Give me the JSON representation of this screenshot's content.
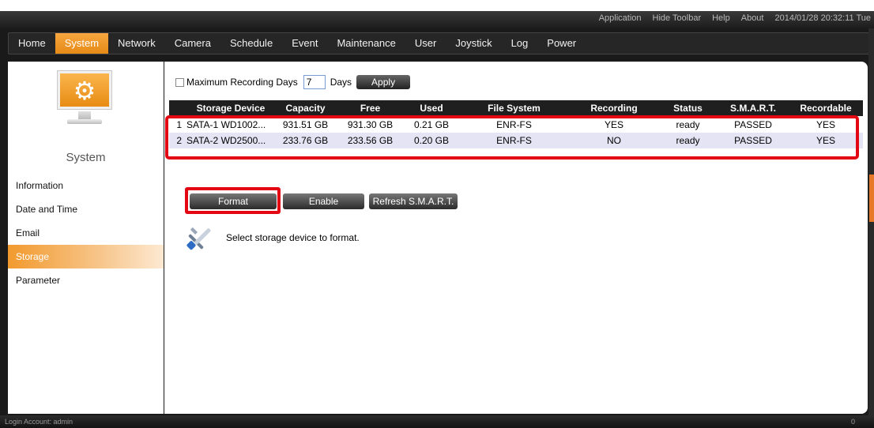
{
  "toolbar": {
    "links": [
      "Application",
      "Hide Toolbar",
      "Help",
      "About"
    ],
    "datetime": "2014/01/28 20:32:11 Tue"
  },
  "nav": {
    "items": [
      "Home",
      "System",
      "Network",
      "Camera",
      "Schedule",
      "Event",
      "Maintenance",
      "User",
      "Joystick",
      "Log",
      "Power"
    ],
    "active": "System"
  },
  "sidebar": {
    "title": "System",
    "items": [
      "Information",
      "Date and Time",
      "Email",
      "Storage",
      "Parameter"
    ],
    "active": "Storage",
    "icon": "settings-monitor-icon"
  },
  "storage": {
    "max_days_label": "Maximum Recording Days",
    "max_days_value": "7",
    "days_label": "Days",
    "apply_label": "Apply",
    "columns": [
      "Storage Device",
      "Capacity",
      "Free",
      "Used",
      "File System",
      "Recording",
      "Status",
      "S.M.A.R.T.",
      "Recordable"
    ],
    "rows": [
      {
        "idx": "1",
        "device": "SATA-1 WD1002...",
        "capacity": "931.51 GB",
        "free": "931.30 GB",
        "used": "0.21 GB",
        "fs": "ENR-FS",
        "recording": "YES",
        "status": "ready",
        "smart": "PASSED",
        "recordable": "YES"
      },
      {
        "idx": "2",
        "device": "SATA-2 WD2500...",
        "capacity": "233.76 GB",
        "free": "233.56 GB",
        "used": "0.20 GB",
        "fs": "ENR-FS",
        "recording": "NO",
        "status": "ready",
        "smart": "PASSED",
        "recordable": "YES"
      }
    ],
    "buttons": {
      "format": "Format",
      "enable": "Enable",
      "refresh": "Refresh S.M.A.R.T."
    },
    "hint": "Select storage device to format."
  },
  "status": {
    "login": "Login Account: admin",
    "right": "0"
  },
  "colors": {
    "accent": "#f29a2e",
    "highlight": "#e30613"
  }
}
